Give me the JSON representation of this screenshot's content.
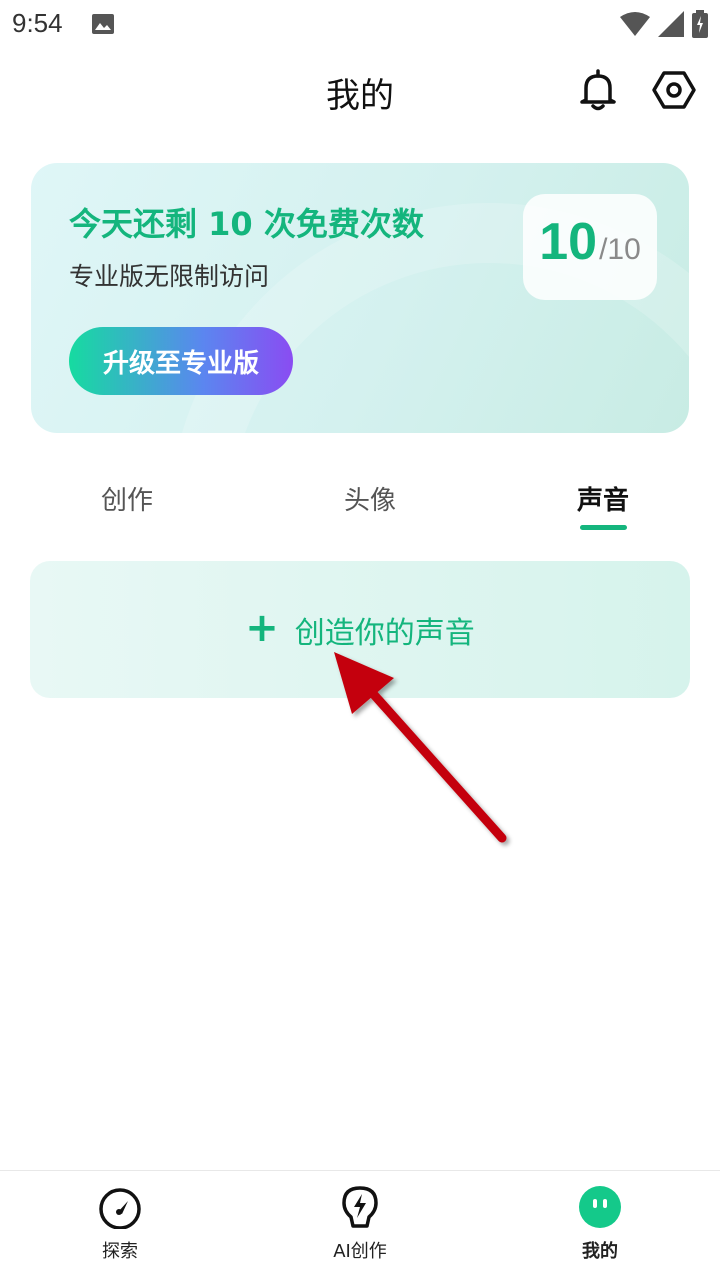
{
  "status_bar": {
    "time": "9:54"
  },
  "header": {
    "title": "我的"
  },
  "promo": {
    "title": "今天还剩 10 次免费次数",
    "subtitle": "专业版无限制访问",
    "upgrade_label": "升级至专业版",
    "remaining": "10",
    "total": "/10"
  },
  "tabs": [
    {
      "label": "创作",
      "selected": false
    },
    {
      "label": "头像",
      "selected": false
    },
    {
      "label": "声音",
      "selected": true
    }
  ],
  "create_voice": {
    "plus": "+",
    "label": "创造你的声音"
  },
  "bottom_nav": [
    {
      "label": "探索",
      "icon": "gauge-icon"
    },
    {
      "label": "AI创作",
      "icon": "lightbulb-bolt-icon"
    },
    {
      "label": "我的",
      "icon": "smiley-icon",
      "active": true
    }
  ],
  "colors": {
    "accent": "#14b57d",
    "annotation_arrow": "#c4000b"
  }
}
